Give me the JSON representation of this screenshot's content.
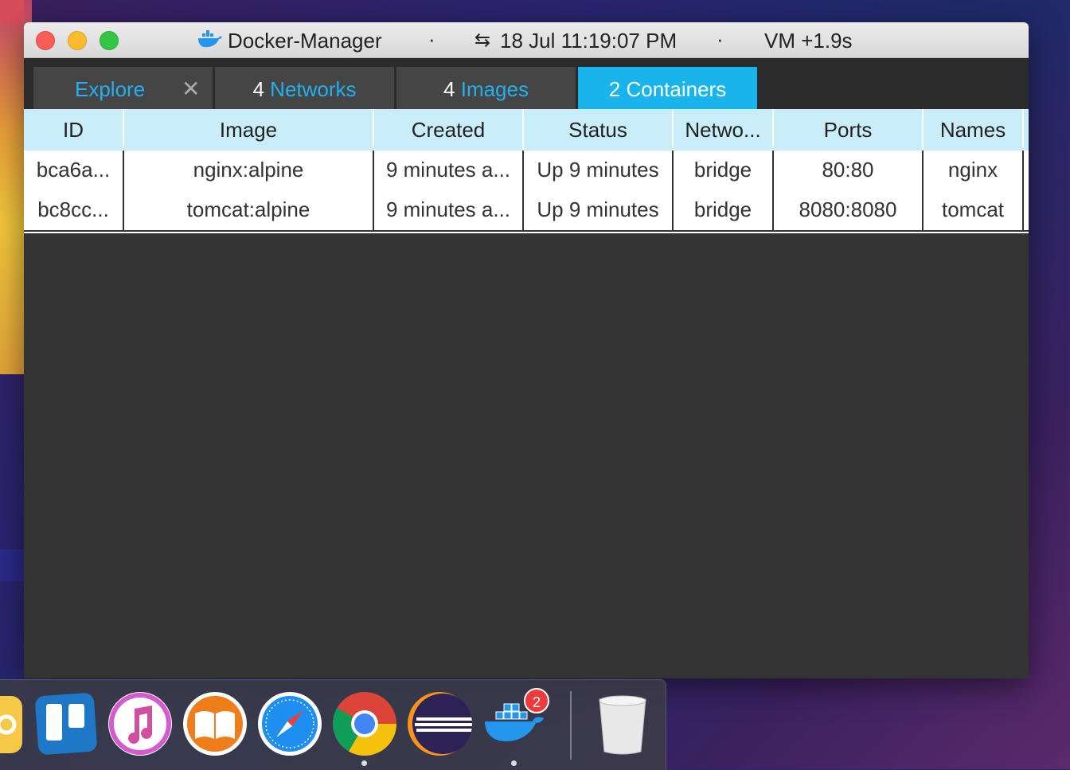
{
  "titlebar": {
    "app_title": "Docker-Manager",
    "separator": "·",
    "swap_glyph": "⇆",
    "datetime": "18 Jul 11:19:07 PM",
    "vm_status": "VM +1.9s"
  },
  "tabs": [
    {
      "label": "Explore",
      "close": "✕"
    },
    {
      "count": "4",
      "label": "Networks"
    },
    {
      "count": "4",
      "label": "Images"
    },
    {
      "count": "2",
      "label": "Containers",
      "active": true
    }
  ],
  "table": {
    "headers": [
      "ID",
      "Image",
      "Created",
      "Status",
      "Netwo...",
      "Ports",
      "Names"
    ],
    "rows": [
      [
        "bca6a...",
        "nginx:alpine",
        "9 minutes a...",
        "Up 9 minutes",
        "bridge",
        "80:80",
        "nginx"
      ],
      [
        "bc8cc...",
        "tomcat:alpine",
        "9 minutes a...",
        "Up 9 minutes",
        "bridge",
        "8080:8080",
        "tomcat"
      ]
    ]
  },
  "dock": {
    "docker_badge": "2",
    "icons": [
      "notes-icon",
      "trello-icon",
      "itunes-icon",
      "ibooks-icon",
      "safari-icon",
      "chrome-icon",
      "eclipse-icon",
      "docker-icon",
      "trash-icon"
    ]
  },
  "colors": {
    "accent": "#19b4ec",
    "table_header": "#c9eef9",
    "window_bg": "#333333"
  }
}
